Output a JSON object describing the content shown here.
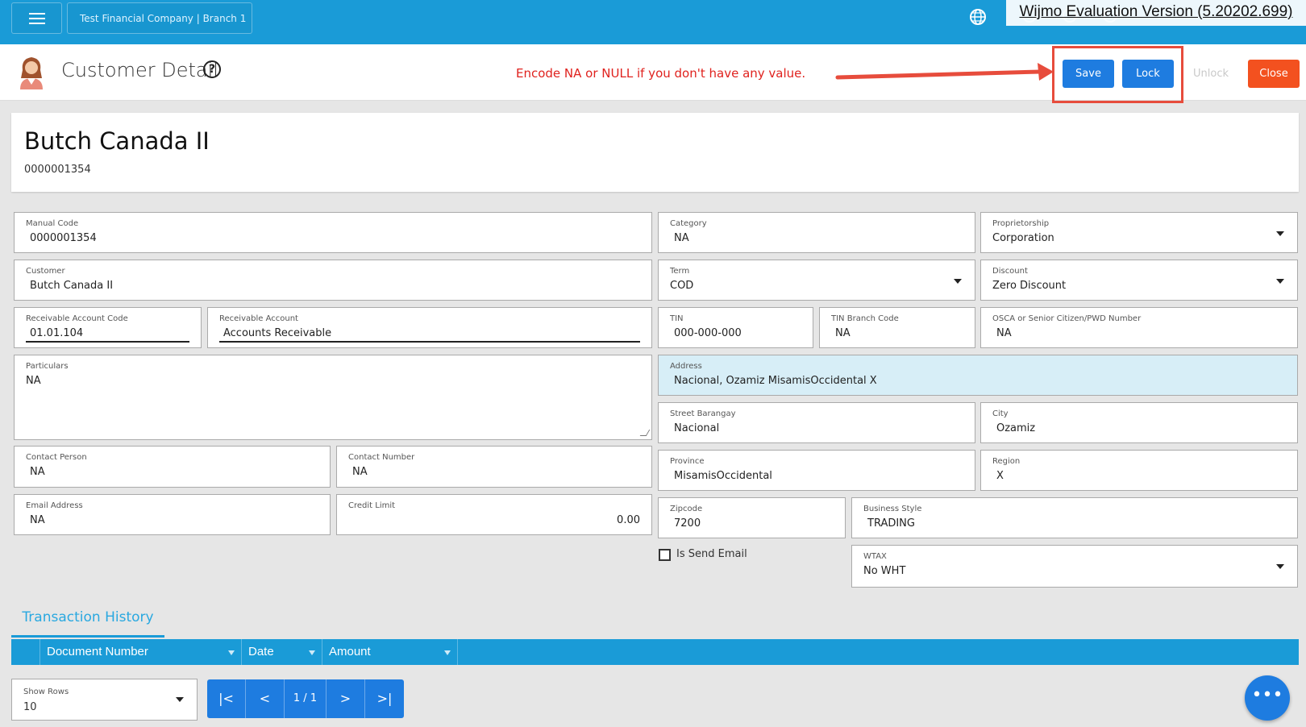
{
  "topbar": {
    "company": "Test Financial Company | Branch 1",
    "wijmo_notice": "Wijmo Evaluation Version (5.20202.699)"
  },
  "header": {
    "title": "Customer Detail",
    "help_glyph": "?",
    "notice": "Encode NA or NULL if you don't have any value.",
    "buttons": {
      "save": "Save",
      "lock": "Lock",
      "unlock": "Unlock",
      "close": "Close"
    }
  },
  "customer": {
    "name": "Butch Canada II",
    "code": "0000001354"
  },
  "fields": {
    "manual_code": {
      "label": "Manual Code",
      "value": "0000001354"
    },
    "category": {
      "label": "Category",
      "value": "NA"
    },
    "proprietorship": {
      "label": "Proprietorship",
      "value": "Corporation"
    },
    "customer": {
      "label": "Customer",
      "value": "Butch Canada II"
    },
    "term": {
      "label": "Term",
      "value": "COD"
    },
    "discount": {
      "label": "Discount",
      "value": "Zero Discount"
    },
    "receivable_account_code": {
      "label": "Receivable Account Code",
      "value": "01.01.104"
    },
    "receivable_account": {
      "label": "Receivable Account",
      "value": "Accounts Receivable"
    },
    "tin": {
      "label": "TIN",
      "value": "000-000-000"
    },
    "tin_branch_code": {
      "label": "TIN Branch Code",
      "value": "NA"
    },
    "osca": {
      "label": "OSCA or Senior Citizen/PWD Number",
      "value": "NA"
    },
    "particulars": {
      "label": "Particulars",
      "value": "NA"
    },
    "address": {
      "label": "Address",
      "value": "Nacional, Ozamiz MisamisOccidental X"
    },
    "street_barangay": {
      "label": "Street Barangay",
      "value": "Nacional"
    },
    "city": {
      "label": "City",
      "value": "Ozamiz"
    },
    "contact_person": {
      "label": "Contact Person",
      "value": "NA"
    },
    "contact_number": {
      "label": "Contact Number",
      "value": "NA"
    },
    "province": {
      "label": "Province",
      "value": "MisamisOccidental"
    },
    "region": {
      "label": "Region",
      "value": "X"
    },
    "email": {
      "label": "Email Address",
      "value": "NA"
    },
    "credit_limit": {
      "label": "Credit Limit",
      "value": "0.00"
    },
    "zipcode": {
      "label": "Zipcode",
      "value": "7200"
    },
    "business_style": {
      "label": "Business Style",
      "value": "TRADING"
    },
    "wtax": {
      "label": "WTAX",
      "value": "No WHT"
    },
    "is_send_email": {
      "label": "Is Send Email",
      "checked": false
    }
  },
  "history": {
    "tab": "Transaction History",
    "columns": [
      "Document Number",
      "Date",
      "Amount"
    ],
    "show_rows_label": "Show Rows",
    "show_rows_value": "10",
    "pager": {
      "first": "|<",
      "prev": "<",
      "page": "1 / 1",
      "next": ">",
      "last": ">|"
    },
    "fab": "•••"
  },
  "colors": {
    "primary": "#1a9bd7",
    "button": "#1e7ce0",
    "close": "#f3511f",
    "notice": "#e0221e",
    "highlight": "#e74c3c"
  }
}
